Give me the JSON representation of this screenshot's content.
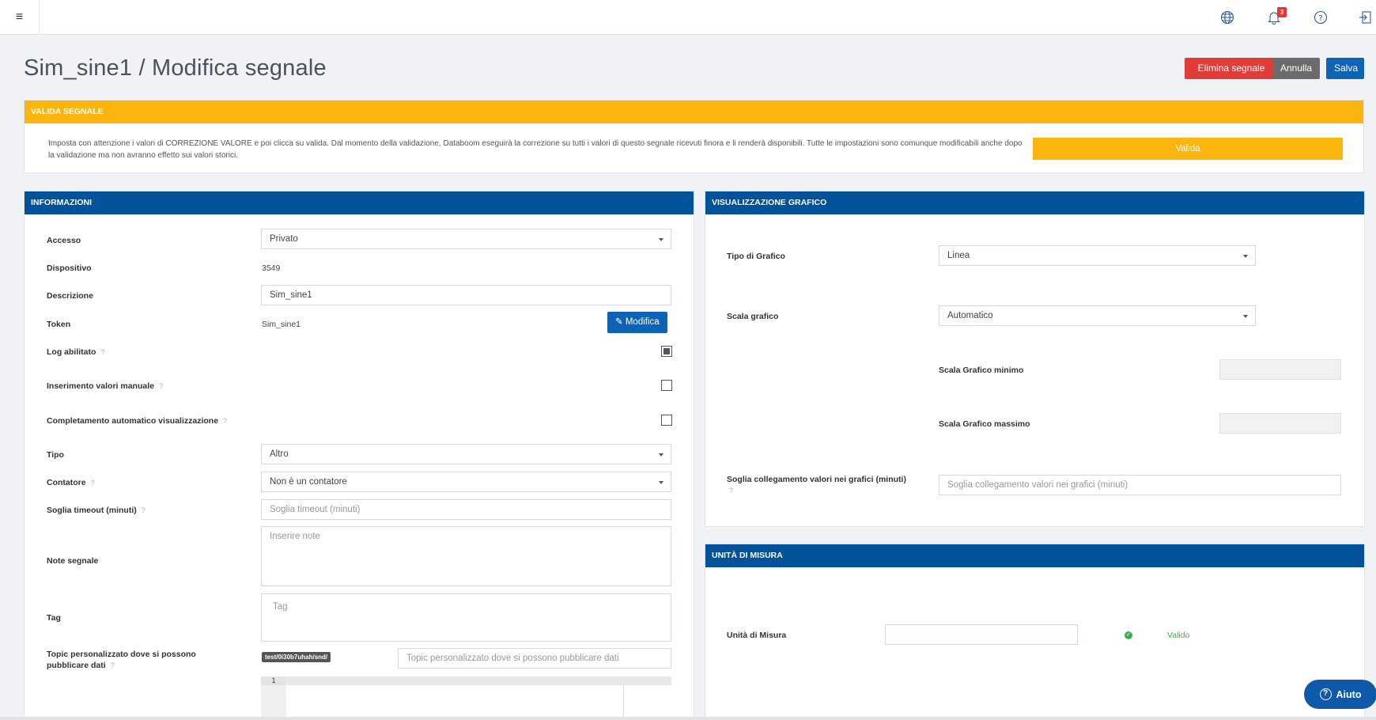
{
  "topbar": {
    "menu_icon": "hamburger-icon",
    "icons": [
      "globe-icon",
      "bell-icon",
      "help-circle-icon",
      "logout-icon"
    ],
    "notifications_count": "3"
  },
  "page": {
    "title": "Sim_sine1 / Modifica segnale",
    "actions": {
      "delete": "Elimina segnale",
      "cancel": "Annulla",
      "save": "Salva"
    }
  },
  "valida": {
    "header": "VALIDA SEGNALE",
    "text": "Imposta con attenzione i valori di CORREZIONE VALORE e poi clicca su valida. Dal momento della validazione, Databoom eseguirà la correzione su tutti i valori di questo segnale ricevuti finora e li renderà disponibili. Tutte le impostazioni sono comunque modificabili anche dopo la validazione ma non avranno effetto sui valori storici.",
    "button": "Valida"
  },
  "info": {
    "header": "INFORMAZIONI",
    "accesso_label": "Accesso",
    "accesso_value": "Privato",
    "dispositivo_label": "Dispositivo",
    "dispositivo_value": "3549",
    "descrizione_label": "Descrizione",
    "descrizione_value": "Sim_sine1",
    "token_label": "Token",
    "token_value": "Sim_sine1",
    "modifica_button": "Modifica",
    "log_label": "Log abilitato",
    "log_checked": true,
    "manuale_label": "Inserimento valori manuale",
    "manuale_checked": false,
    "completamento_label": "Completamento automatico visualizzazione",
    "completamento_checked": false,
    "tipo_label": "Tipo",
    "tipo_value": "Altro",
    "contatore_label": "Contatore",
    "contatore_value": "Non è un contatore",
    "soglia_label": "Soglia timeout (minuti)",
    "soglia_placeholder": "Soglia timeout (minuti)",
    "note_label": "Note segnale",
    "note_placeholder": "Inserire note",
    "tag_label": "Tag",
    "tag_placeholder": "Tag",
    "topic_label": "Topic personalizzato dove si possono pubblicare dati",
    "topic_prefix": "test/0i30b7uhah/snd/",
    "topic_placeholder": "Topic personalizzato dove si possono pubblicare dati",
    "code_line_number": "1",
    "help_mark": "?"
  },
  "grafico": {
    "header": "VISUALIZZAZIONE GRAFICO",
    "tipo_label": "Tipo di Grafico",
    "tipo_value": "Linea",
    "scala_label": "Scala grafico",
    "scala_value": "Automatico",
    "min_label": "Scala Grafico minimo",
    "max_label": "Scala Grafico massimo",
    "soglia_label": "Soglia collegamento valori nei grafici (minuti)",
    "soglia_placeholder": "Soglia collegamento valori nei grafici (minuti)"
  },
  "unita": {
    "header": "UNITÀ DI MISURA",
    "label": "Unità di Misura",
    "value": "",
    "status": "Valido"
  },
  "help_button": "Aiuto"
}
